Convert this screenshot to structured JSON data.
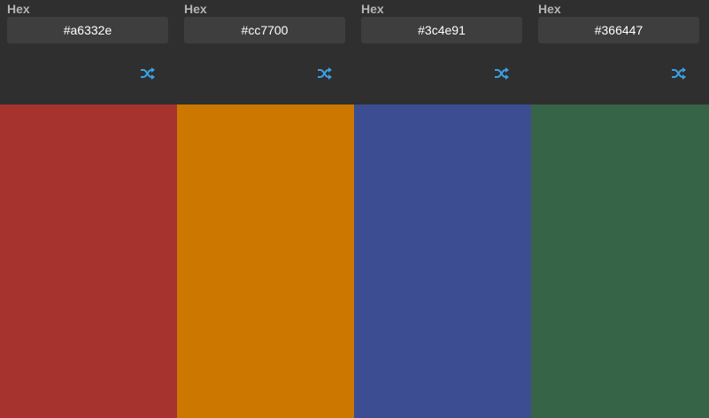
{
  "columns": [
    {
      "label": "Hex",
      "hex": "#a6332e",
      "color": "#a6332e"
    },
    {
      "label": "Hex",
      "hex": "#cc7700",
      "color": "#cc7700"
    },
    {
      "label": "Hex",
      "hex": "#3c4e91",
      "color": "#3c4e91"
    },
    {
      "label": "Hex",
      "hex": "#366447",
      "color": "#366447"
    }
  ],
  "accent": "#3aa0e6",
  "icons": {
    "shuffle": "shuffle-icon"
  }
}
